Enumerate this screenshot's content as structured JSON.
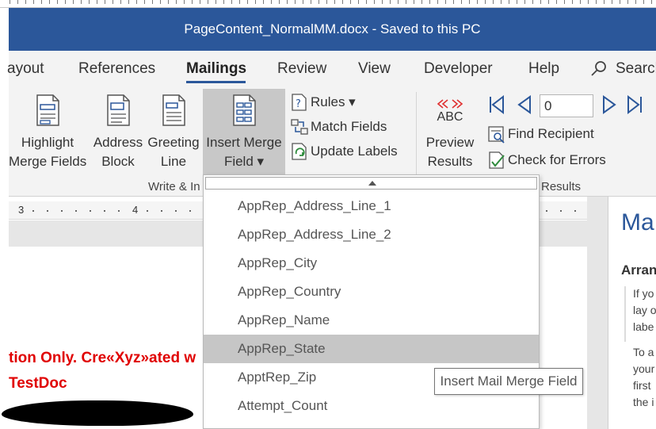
{
  "window": {
    "title": "PageContent_NormalMM.docx  -  Saved to this PC"
  },
  "tabs": [
    {
      "label": "ayout"
    },
    {
      "label": "References"
    },
    {
      "label": "Mailings",
      "active": true
    },
    {
      "label": "Review"
    },
    {
      "label": "View"
    },
    {
      "label": "Developer"
    },
    {
      "label": "Help"
    }
  ],
  "search": {
    "label": "Search"
  },
  "ribbon": {
    "highlight": {
      "line1": "Highlight",
      "line2": "Merge Fields"
    },
    "address": {
      "line1": "Address",
      "line2": "Block"
    },
    "greeting": {
      "line1": "Greeting",
      "line2": "Line"
    },
    "insert_merge": {
      "line1": "Insert Merge",
      "line2": "Field ▾"
    },
    "rules": "Rules ▾",
    "match_fields": "Match Fields",
    "update_labels": "Update Labels",
    "preview_abc": "ABC",
    "preview": {
      "line1": "Preview",
      "line2": "Results"
    },
    "record_number": "0",
    "find_recipient": "Find Recipient",
    "check_errors": "Check for Errors",
    "group_write": "Write & In",
    "group_preview": "Results"
  },
  "ruler": {
    "n3": "3",
    "n4": "4"
  },
  "document": {
    "line1": "tion Only. Cre«Xyz»ated w",
    "line2": "TestDoc"
  },
  "pane": {
    "title": "Ma",
    "subtitle": "Arran",
    "lines": [
      "If yo",
      "lay o",
      "labe",
      "To a",
      "your",
      "first",
      "the i"
    ]
  },
  "dropdown": {
    "items": [
      {
        "label": "AppRep_Address_Line_1"
      },
      {
        "label": "AppRep_Address_Line_2"
      },
      {
        "label": "AppRep_City"
      },
      {
        "label": "AppRep_Country"
      },
      {
        "label": "AppRep_Name"
      },
      {
        "label": "AppRep_State",
        "highlighted": true
      },
      {
        "label": "ApptRep_Zip"
      },
      {
        "label": "Attempt_Count"
      }
    ]
  },
  "tooltip": {
    "text": "Insert Mail Merge Field"
  },
  "colors": {
    "accent": "#2b579a",
    "ribbon_bg": "#f3f3f3",
    "doc_text": "#e00000",
    "highlight": "#c6c6c6"
  }
}
